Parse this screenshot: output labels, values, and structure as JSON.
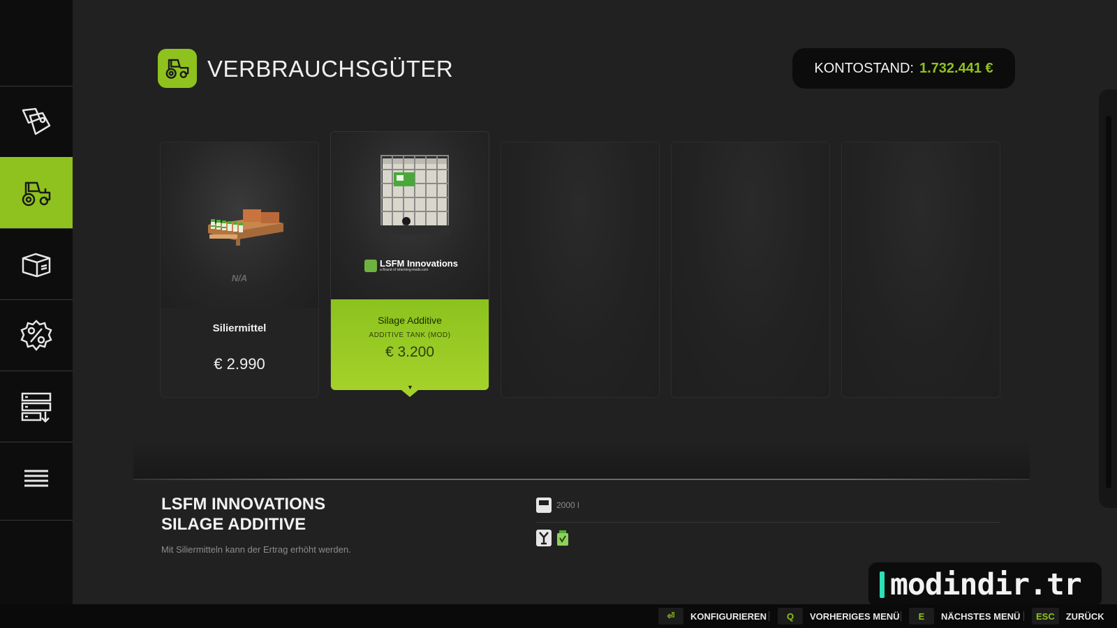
{
  "header": {
    "title": "VERBRAUCHSGÜTER",
    "title_icon": "tractor-icon",
    "balance_label": "KONTOSTAND:",
    "balance_value": "1.732.441 €"
  },
  "sidebar": {
    "items": [
      {
        "name": "tags",
        "icon": "price-tags-icon"
      },
      {
        "name": "vehicles",
        "icon": "tractor-icon",
        "active": true
      },
      {
        "name": "packages",
        "icon": "box-icon"
      },
      {
        "name": "sales",
        "icon": "percent-icon"
      },
      {
        "name": "storage",
        "icon": "storage-rack-icon"
      },
      {
        "name": "list",
        "icon": "list-icon"
      }
    ]
  },
  "items": [
    {
      "name": "Siliermittel",
      "price": "€ 2.990",
      "availability": "N/A"
    },
    {
      "name": "Silage Additive",
      "subtitle": "ADDITIVE TANK (MOD)",
      "price": "€ 3.200",
      "brand": "LSFM Innovations",
      "brand_tag": "a Brand of lsfarming-mods.com",
      "selected": true
    }
  ],
  "details": {
    "title_line1": "LSFM INNOVATIONS",
    "title_line2": "SILAGE ADDITIVE",
    "description": "Mit Siliermitteln kann der Ertrag erhöht werden.",
    "capacity": "2000 l"
  },
  "watermark": "modindir.tr",
  "footer": {
    "hints": [
      {
        "key": "⏎",
        "label": "KONFIGURIEREN"
      },
      {
        "key": "Q",
        "label": "VORHERIGES MENÜ"
      },
      {
        "key": "E",
        "label": "NÄCHSTES MENÜ"
      },
      {
        "key": "ESC",
        "label": "ZURÜCK"
      }
    ]
  },
  "colors": {
    "accent": "#8fc21e",
    "background": "#212121",
    "sidebar": "#0d0d0d"
  }
}
